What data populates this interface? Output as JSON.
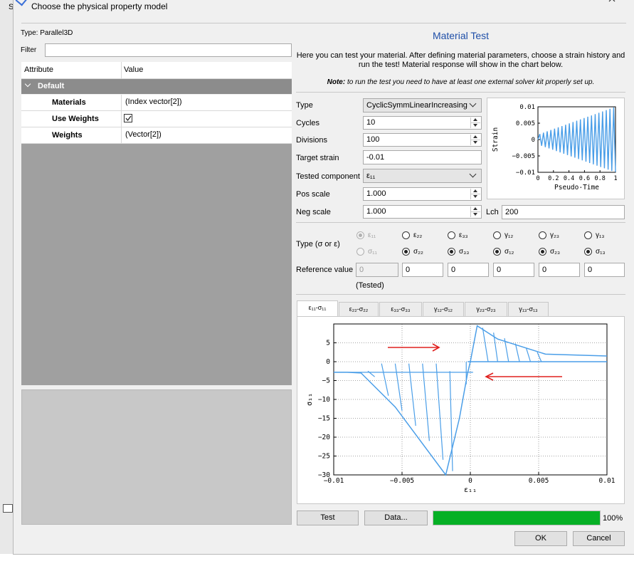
{
  "background": {
    "left_letter": "S"
  },
  "header": {
    "title": "Choose the physical property model"
  },
  "left": {
    "type_label": "Type: Parallel3D",
    "filter_label": "Filter",
    "filter_value": "",
    "columns": {
      "attribute": "Attribute",
      "value": "Value"
    },
    "group": "Default",
    "rows": [
      {
        "attribute": "Materials",
        "value": "(Index vector[2])"
      },
      {
        "attribute": "Use Weights",
        "value": ""
      },
      {
        "attribute": "Weights",
        "value": "(Vector[2])"
      }
    ]
  },
  "right": {
    "title": "Material Test",
    "description": "Here you can test your material. After defining material parameters, choose a strain history and run the test! Material response will show in the chart below.",
    "note_bold": "Note:",
    "note_text": " to run the test you need to have at least one external solver kit properly set up.",
    "form": {
      "type_label": "Type",
      "type_value": "CyclicSymmLinearIncreasing",
      "cycles_label": "Cycles",
      "cycles_value": "10",
      "divisions_label": "Divisions",
      "divisions_value": "100",
      "target_label": "Target strain",
      "target_value": "-0.01",
      "component_label": "Tested component",
      "component_value": "ε₁₁",
      "pos_label": "Pos scale",
      "pos_value": "1.000",
      "neg_label": "Neg scale",
      "neg_value": "1.000",
      "lch_label": "Lch",
      "lch_value": "200"
    },
    "type_sigma_label": "Type (σ or ε)",
    "eps_labels": [
      "ε₁₁",
      "ε₂₂",
      "ε₃₃",
      "γ₁₂",
      "γ₂₃",
      "γ₁₃"
    ],
    "sig_labels": [
      "σ₁₁",
      "σ₂₂",
      "σ₃₃",
      "σ₁₂",
      "σ₂₃",
      "σ₁₃"
    ],
    "ref_label": "Reference value",
    "ref_values": [
      "0",
      "0",
      "0",
      "0",
      "0",
      "0"
    ],
    "tested_label": "(Tested)",
    "tabs": [
      "ε₁₁-σ₁₁",
      "ε₂₂-σ₂₂",
      "ε₃₃-σ₃₃",
      "γ₁₂-σ₁₂",
      "γ₂₃-σ₂₃",
      "γ₁₃-σ₁₃"
    ],
    "buttons": {
      "test": "Test",
      "data": "Data...",
      "ok": "OK",
      "cancel": "Cancel"
    },
    "progress_text": "100%"
  },
  "colors": {
    "accent": "#1f4fa8",
    "line": "#4a9ee8",
    "progress": "#06b025",
    "arrow": "#e0201e",
    "group_header": "#8c8c8c"
  },
  "chart_data": [
    {
      "type": "line",
      "xlabel": "Pseudo-Time",
      "ylabel": "Strain",
      "xlim": [
        0,
        1
      ],
      "ylim": [
        -0.01,
        0.01
      ],
      "x_ticks": [
        "0",
        "0.2",
        "0.4",
        "0.6",
        "0.8",
        "1"
      ],
      "y_ticks": [
        "0.01",
        "0.005",
        "0",
        "−0.005",
        "−0.01"
      ],
      "series": [
        {
          "x": [
            0,
            0.05,
            0.1,
            0.15,
            0.2,
            0.25,
            0.3,
            0.35,
            0.4,
            0.45,
            0.5,
            0.55,
            0.6,
            0.65,
            0.7,
            0.75,
            0.8,
            0.85,
            0.9,
            0.95,
            1.0
          ],
          "values": [
            0,
            0.001,
            -0.002,
            0.002,
            -0.003,
            0.003,
            -0.004,
            0.004,
            -0.005,
            0.005,
            -0.006,
            0.006,
            -0.007,
            0.007,
            -0.008,
            0.008,
            -0.009,
            0.009,
            -0.01,
            0.01,
            0
          ]
        }
      ]
    },
    {
      "type": "line",
      "xlabel": "ε₁₁",
      "ylabel": "σ₁₁",
      "xlim": [
        -0.01,
        0.01
      ],
      "ylim": [
        -30,
        10
      ],
      "x_ticks": [
        "−0.01",
        "−0.005",
        "0",
        "0.005",
        "0.01"
      ],
      "y_ticks": [
        "5",
        "0",
        "−5",
        "−10",
        "−15",
        "−20",
        "−25",
        "−30"
      ],
      "grid": true,
      "envelope": {
        "x": [
          0.01,
          0.0055,
          0.002,
          0.0005,
          0,
          -0.0002,
          -0.0008,
          -0.0018,
          -0.0055,
          -0.008,
          -0.009,
          -0.01
        ],
        "values": [
          1.5,
          2,
          6,
          9.5,
          0,
          -3,
          -15,
          -30,
          -12,
          -3,
          -2.8,
          -2.8
        ]
      },
      "unload_lines": [
        {
          "x": [
            -0.0003,
            -0.0003
          ],
          "values": [
            0,
            -6
          ]
        },
        {
          "x": [
            -0.0015,
            -0.0013
          ],
          "values": [
            -2.5,
            -29
          ]
        },
        {
          "x": [
            -0.0025,
            -0.002
          ],
          "values": [
            -0.5,
            -26
          ]
        },
        {
          "x": [
            -0.0035,
            -0.003
          ],
          "values": [
            -0.5,
            -21
          ]
        },
        {
          "x": [
            -0.0045,
            -0.004
          ],
          "values": [
            -0.5,
            -17
          ]
        },
        {
          "x": [
            -0.0055,
            -0.005
          ],
          "values": [
            -0.5,
            -13
          ]
        },
        {
          "x": [
            -0.0065,
            -0.006
          ],
          "values": [
            -0.5,
            -9
          ]
        },
        {
          "x": [
            -0.0075,
            -0.007
          ],
          "values": [
            -2.5,
            -4
          ]
        },
        {
          "x": [
            0.0009,
            0.0013
          ],
          "values": [
            9,
            0
          ]
        },
        {
          "x": [
            0.0017,
            0.002
          ],
          "values": [
            7.7,
            0
          ]
        },
        {
          "x": [
            0.0025,
            0.0028
          ],
          "values": [
            6.2,
            0
          ]
        },
        {
          "x": [
            0.0033,
            0.0036
          ],
          "values": [
            4.8,
            0
          ]
        },
        {
          "x": [
            0.0041,
            0.0044
          ],
          "values": [
            3.5,
            0
          ]
        },
        {
          "x": [
            0.0049,
            0.0052
          ],
          "values": [
            2.5,
            0
          ]
        }
      ],
      "annotations": [
        "arrow-right-top",
        "arrow-left-bottom"
      ]
    }
  ]
}
